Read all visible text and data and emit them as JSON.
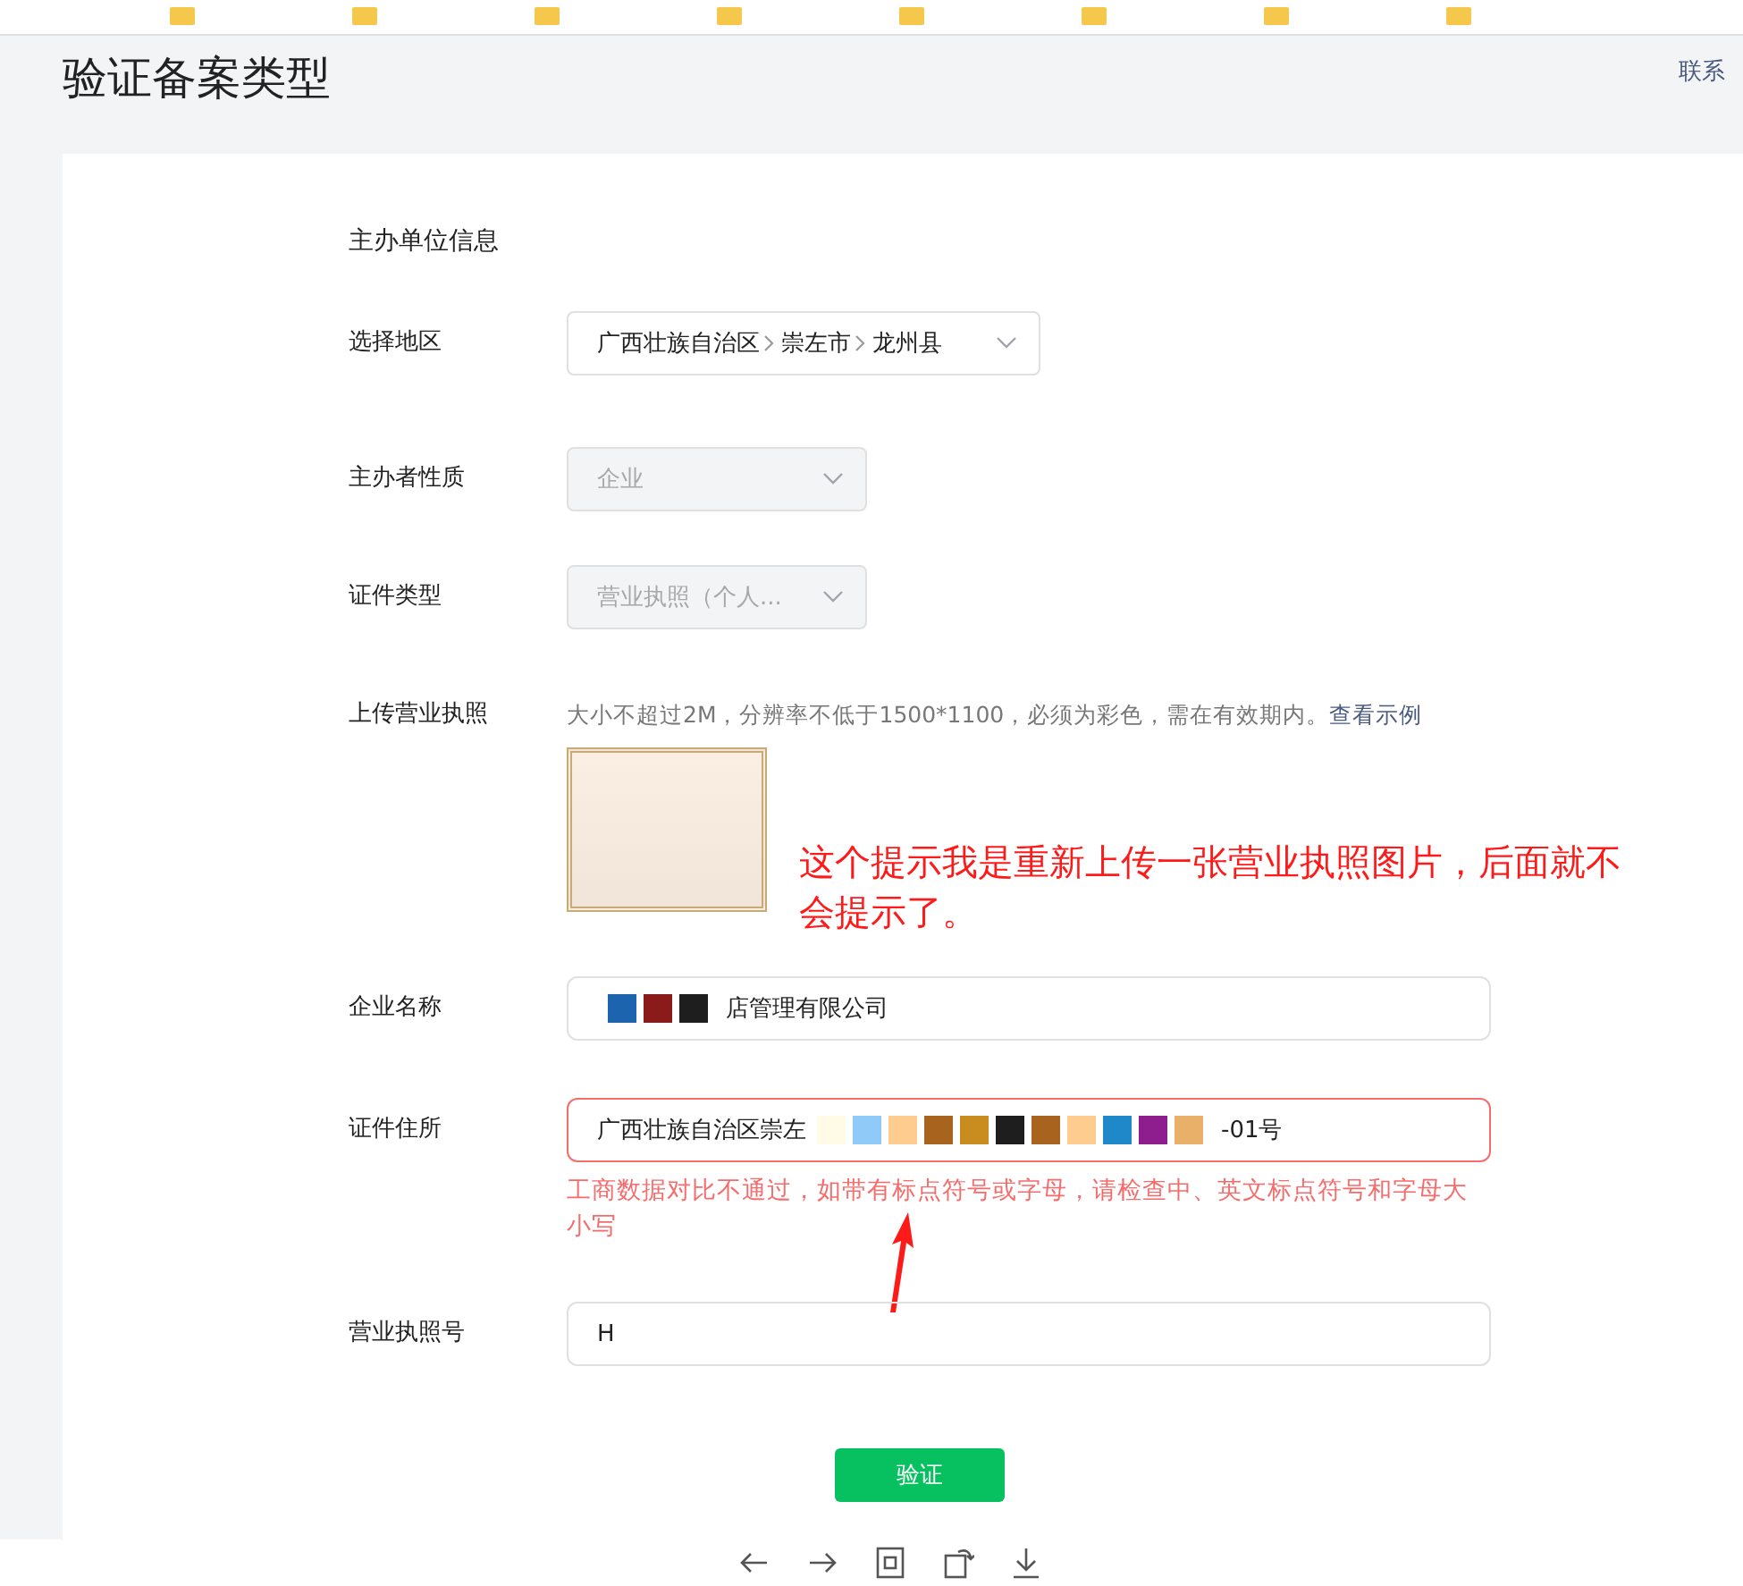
{
  "page": {
    "title": "验证备案类型",
    "contact_link": "联系"
  },
  "form": {
    "section_title": "主办单位信息",
    "rows": [
      {
        "kind": "cascader",
        "label": "选择地区",
        "parts": [
          "广西壮族自治区",
          "崇左市",
          "龙州县"
        ],
        "disabled": false
      },
      {
        "kind": "select",
        "label": "主办者性质",
        "value": "企业",
        "disabled": true
      },
      {
        "kind": "select",
        "label": "证件类型",
        "value": "营业执照（个人...",
        "disabled": true
      },
      {
        "kind": "upload",
        "label": "上传营业执照",
        "hint": "大小不超过2M，分辨率不低于1500*1100，必须为彩色，需在有效期内。",
        "link": "查看示例"
      },
      {
        "kind": "input",
        "label": "企业名称",
        "prefix": "",
        "redactions": [
          {
            "color": "#1c64ae"
          },
          {
            "color": "#8b1a1a"
          },
          {
            "color": "#1e1e1e"
          }
        ],
        "value": "店管理有限公司",
        "error": false
      },
      {
        "kind": "input",
        "label": "证件住所",
        "prefix": "广西壮族自治区崇左",
        "redactions": [
          {
            "color": "#fffbe6"
          },
          {
            "color": "#90caf9"
          },
          {
            "color": "#ffcc90"
          },
          {
            "color": "#a8641e"
          },
          {
            "color": "#c98c1e"
          },
          {
            "color": "#1e1e1e"
          },
          {
            "color": "#a8641e"
          },
          {
            "color": "#ffcc90"
          },
          {
            "color": "#1e88c8"
          },
          {
            "color": "#8e1e8e"
          },
          {
            "color": "#e8b068"
          }
        ],
        "value": "-01号",
        "error": true,
        "error_message": "工商数据对比不通过，如带有标点符号或字母，请检查中、英文标点符号和字母大小写"
      },
      {
        "kind": "input",
        "label": "营业执照号",
        "prefix": "",
        "redactions": [],
        "value": "H",
        "error": false
      }
    ],
    "submit": "验证"
  },
  "annotation": {
    "text": "这个提示我是重新上传一张营业执照图片，后面就不会提示了。"
  }
}
